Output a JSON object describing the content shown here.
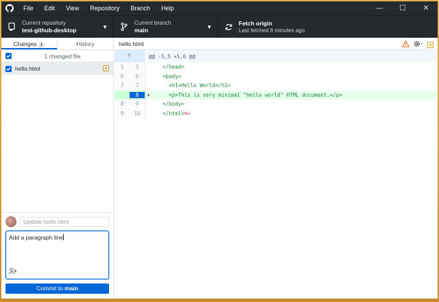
{
  "menu": [
    "File",
    "Edit",
    "View",
    "Repository",
    "Branch",
    "Help"
  ],
  "window_controls": {
    "minimize": "—",
    "maximize": "☐",
    "close": "✕"
  },
  "toolbar": {
    "repo_label": "Current repository",
    "repo_name": "test-github-desktop",
    "branch_label": "Current branch",
    "branch_name": "main",
    "fetch_label": "Fetch origin",
    "fetch_status": "Last fetched 6 minutes ago"
  },
  "tabs": {
    "changes": "Changes",
    "changes_count": "1",
    "history": "History"
  },
  "changes_header": "1 changed file",
  "files": [
    {
      "name": "hello.html"
    }
  ],
  "commit": {
    "summary_placeholder": "Update hello.html",
    "description": "Add a paragraph line",
    "button_prefix": "Commit to ",
    "button_branch": "main"
  },
  "diff": {
    "file": "hello.html",
    "hunk_expand": "⤒",
    "hunk_header": "@@ -5,5 +5,6 @@",
    "lines": [
      {
        "old": "5",
        "new": "5",
        "sign": "",
        "text": "  </head>"
      },
      {
        "old": "6",
        "new": "6",
        "sign": "",
        "text": "  <body>"
      },
      {
        "old": "7",
        "new": "7",
        "sign": "",
        "text": "    <h1>Hello World</h1>"
      },
      {
        "old": "",
        "new": "8",
        "sign": "+",
        "text": "    <p>This is very minimal \"hello world\" HTML document.</p>"
      },
      {
        "old": "8",
        "new": "9",
        "sign": "",
        "text": "  </body>"
      },
      {
        "old": "9",
        "new": "10",
        "sign": "",
        "text": "  </html>"
      }
    ]
  },
  "colors": {
    "accent": "#0366d6",
    "toolbar_bg": "#24292e",
    "added_bg": "#e6ffed",
    "modified": "#d4a72c"
  }
}
